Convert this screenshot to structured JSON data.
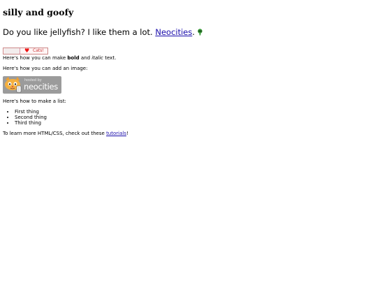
{
  "page": {
    "title": "silly and goofy",
    "lead_text": "Do you like jellyfish? I like them a lot.",
    "lead_link": "Neocities",
    "lead_suffix": ".",
    "badge": {
      "text": "Cats!"
    },
    "para_bold": {
      "prefix": "Here's how you can make",
      "bold": "bold",
      "middle": "and",
      "italic": "italic",
      "suffix": "text."
    },
    "para_image": "Here's how you can add an image:",
    "logo": {
      "small_text": "hosted by",
      "big_text": "neocities"
    },
    "para_list": "Here's how to make a list:",
    "list_items": [
      "First thing",
      "Second thing",
      "Third thing"
    ],
    "para_learn": {
      "prefix": "To learn more HTML/CSS, check out these",
      "link": "tutorials",
      "suffix": "!"
    },
    "colors": {
      "link": "#1a0dab",
      "logo_bg": "#9b9b9b",
      "alien": "#3a9a3a"
    }
  }
}
